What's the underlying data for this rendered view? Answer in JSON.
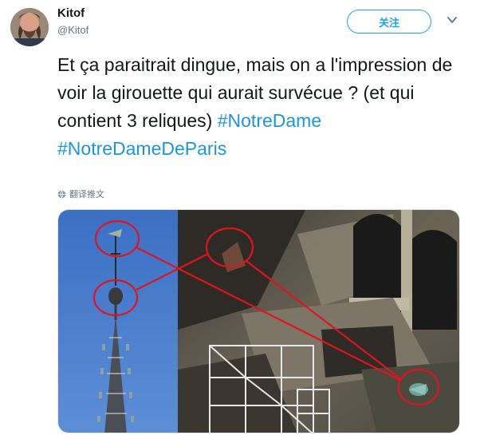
{
  "author": {
    "name": "Kitof",
    "handle": "@Kitof",
    "avatar_icon": "profile-photo-icon"
  },
  "header": {
    "follow_label": "关注",
    "more_icon": "chevron-down-icon"
  },
  "tweet": {
    "text_before": "Et ça paraitrait dingue, mais on a l'impression de voir la girouette qui aurait survécue ? (et qui contient 3 reliques) ",
    "hashtag_1": "#NotreDame",
    "hashtag_2": "#NotreDameDeParis"
  },
  "translate": {
    "label": "翻译推文",
    "icon": "globe-icon"
  },
  "media": {
    "left_photo": "spire-photo",
    "right_photo": "rubble-photo",
    "annotation_color": "#e0141e"
  },
  "colors": {
    "accent": "#1da1f2",
    "hashtag": "#1b95e0",
    "secondary_text": "#657786"
  }
}
